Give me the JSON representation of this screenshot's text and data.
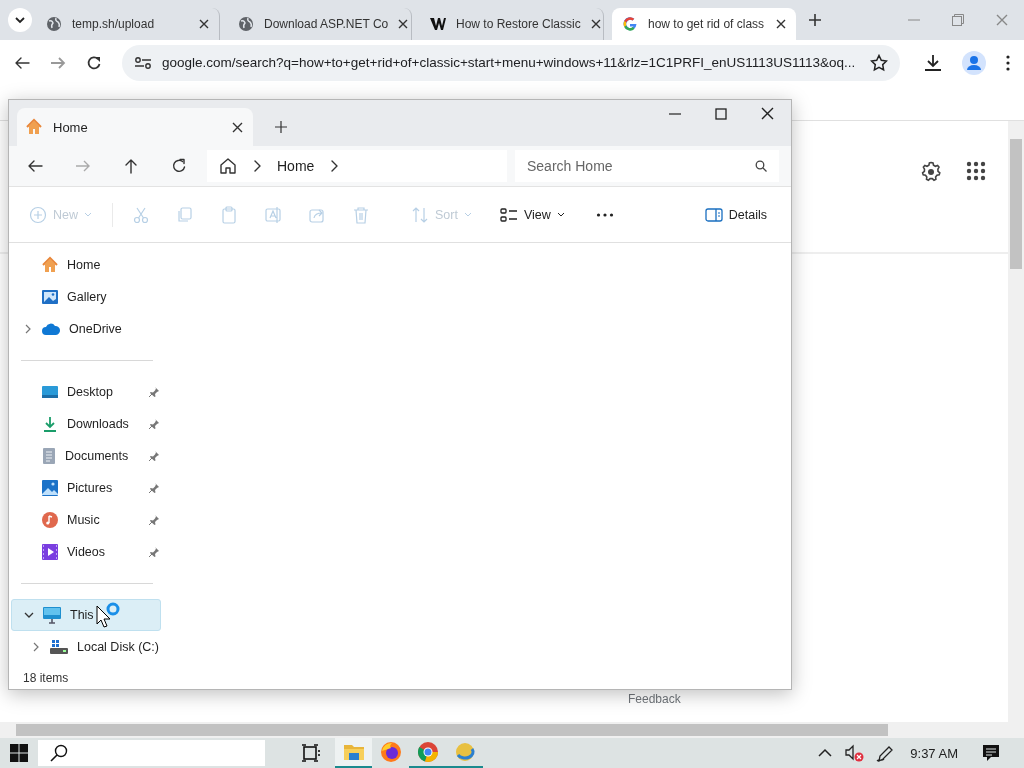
{
  "browser": {
    "tabs": [
      {
        "title": "temp.sh/upload",
        "kind": "globe",
        "selected": false
      },
      {
        "title": "Download ASP.NET Co",
        "kind": "globe",
        "selected": false
      },
      {
        "title": "How to Restore Classic",
        "kind": "w",
        "selected": false
      },
      {
        "title": "how to get rid of class",
        "kind": "g",
        "selected": true
      }
    ],
    "address": "google.com/search?q=how+to+get+rid+of+classic+start+menu+windows+11&rlz=1C1PRFI_enUS1113US1113&oq...",
    "page": {
      "feedback": "Feedback"
    }
  },
  "explorer": {
    "tab": {
      "title": "Home"
    },
    "breadcrumb": [
      "Home"
    ],
    "search": {
      "placeholder": "Search Home"
    },
    "toolbar": [
      {
        "kind": "new",
        "label": "New",
        "disabled": true
      },
      {
        "kind": "cut",
        "disabled": true
      },
      {
        "kind": "copy",
        "disabled": true
      },
      {
        "kind": "paste",
        "disabled": true
      },
      {
        "kind": "rename",
        "disabled": true
      },
      {
        "kind": "share",
        "disabled": true
      },
      {
        "kind": "delete",
        "disabled": true
      },
      {
        "kind": "sort",
        "label": "Sort",
        "disabled": true
      },
      {
        "kind": "view",
        "label": "View",
        "disabled": false
      },
      {
        "kind": "more",
        "disabled": false
      },
      {
        "kind": "details",
        "label": "Details",
        "disabled": false
      }
    ],
    "sidebar": [
      {
        "kind": "home",
        "label": "Home",
        "selected": false
      },
      {
        "kind": "gallery",
        "label": "Gallery",
        "selected": false
      },
      {
        "kind": "cloud",
        "label": "OneDrive",
        "selected": false,
        "expanded": false
      },
      {
        "kind": "divider"
      },
      {
        "kind": "desktop",
        "label": "Desktop",
        "pinned": true,
        "selected": false
      },
      {
        "kind": "download",
        "label": "Downloads",
        "pinned": true,
        "selected": false
      },
      {
        "kind": "documents",
        "label": "Documents",
        "pinned": true,
        "selected": false
      },
      {
        "kind": "pictures",
        "label": "Pictures",
        "pinned": true,
        "selected": false
      },
      {
        "kind": "music",
        "label": "Music",
        "pinned": true,
        "selected": false
      },
      {
        "kind": "videos",
        "label": "Videos",
        "pinned": true,
        "selected": false
      },
      {
        "kind": "divider"
      },
      {
        "kind": "pc",
        "label": "This",
        "selected": true,
        "expanded": true,
        "children": [
          {
            "kind": "disk",
            "label": "Local Disk (C:)",
            "selected": false,
            "expanded": false
          }
        ]
      }
    ],
    "status": "18 items"
  },
  "taskbar": {
    "apps": [
      {
        "kind": "explorer",
        "running": true,
        "selected": true
      },
      {
        "kind": "firefox",
        "running": false,
        "selected": false
      },
      {
        "kind": "chrome",
        "running": true,
        "selected": false
      },
      {
        "kind": "other",
        "running": true,
        "selected": false
      }
    ],
    "clock": "9:37 AM"
  }
}
